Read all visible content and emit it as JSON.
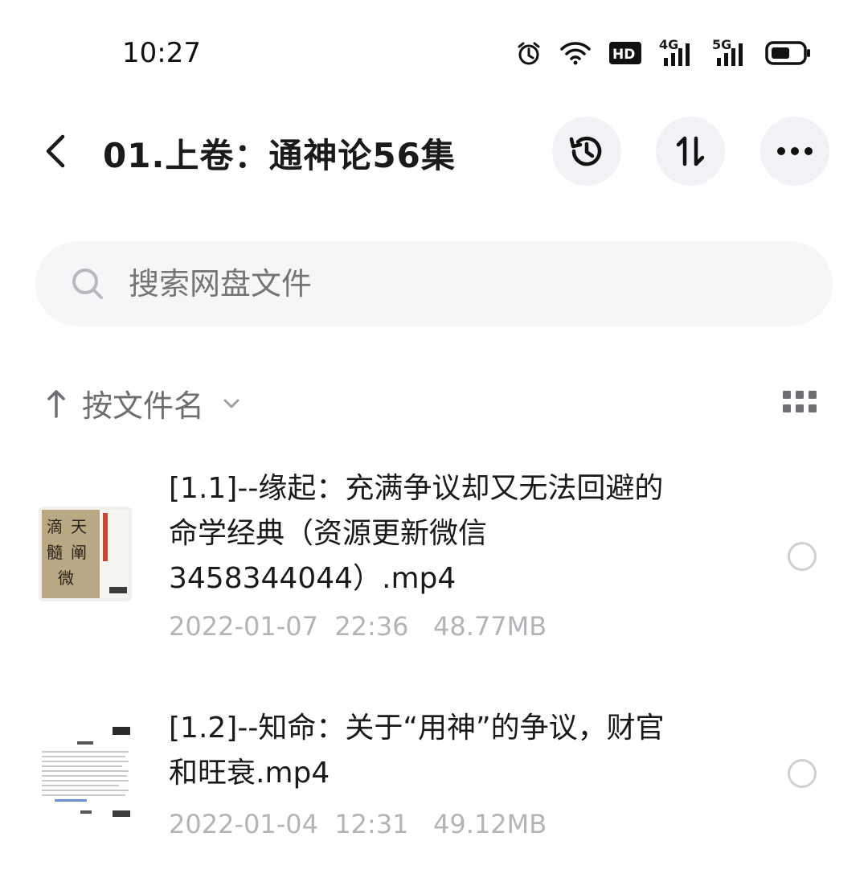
{
  "status_bar": {
    "time": "10:27",
    "icons": [
      "alarm-icon",
      "wifi-icon",
      "hd-icon",
      "signal-4g-icon",
      "signal-5g-icon",
      "battery-icon"
    ],
    "hd_label": "HD",
    "net1": "4G",
    "net2": "5G"
  },
  "header": {
    "title": "01.上卷：通神论56集",
    "buttons": [
      "history-icon",
      "sort-icon",
      "more-icon"
    ]
  },
  "search": {
    "placeholder": "搜索网盘文件"
  },
  "sort": {
    "label": "按文件名"
  },
  "files": [
    {
      "name": "[1.1]--缘起：充满争议却又无法回避的命学经典（资源更新微信3458344044）.mp4",
      "date": "2022-01-07",
      "time": "22:36",
      "size": "48.77MB",
      "thumbnail": "book-cover-thumbnail"
    },
    {
      "name": "[1.2]--知命：关于“用神”的争议，财官和旺衰.mp4",
      "date": "2022-01-04",
      "time": "12:31",
      "size": "49.12MB",
      "thumbnail": "document-page-thumbnail"
    }
  ],
  "colors": {
    "background": "#ffffff",
    "button_bg": "#f1f2f5",
    "search_bg": "#f6f6f8",
    "meta_text": "#b3b4b8"
  }
}
